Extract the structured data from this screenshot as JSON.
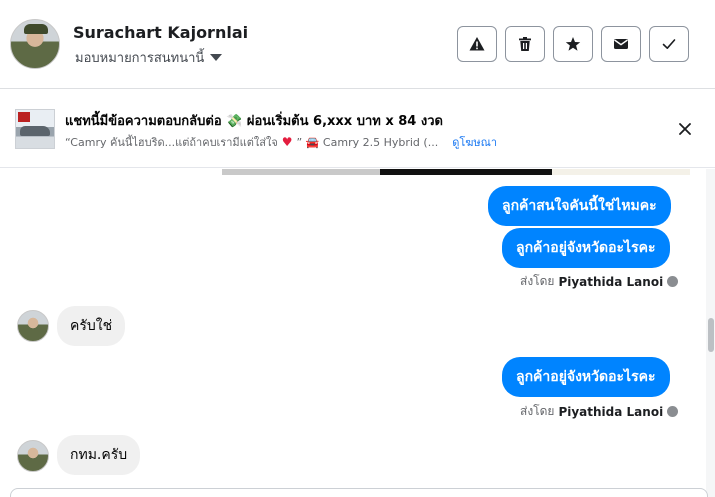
{
  "header": {
    "contact_name": "Surachart Kajornlai",
    "assign_label": "มอบหมายการสนทนานี้",
    "actions": [
      "warning-icon",
      "trash-icon",
      "star-icon",
      "mail-icon",
      "check-icon"
    ]
  },
  "ad": {
    "title": "แชทนี้มีข้อความตอบกลับต่อ 💸 ผ่อนเริ่มต้น 6,xxx บาท x 84 งวด",
    "subtitle_start": "“Camry คันนี้ไฮบริด...แต่ถ้าคบเรามีแต่ใส่ใจ",
    "subtitle_end": "” 🚘 Camry 2.5 Hybrid (...",
    "link": "ดูโฆษณา"
  },
  "messages": {
    "out_1": "ลูกค้าสนใจคันนี้ใช่ไหมคะ",
    "out_2": "ลูกค้าอยู่จังหวัดอะไรคะ",
    "sent_by_prefix": "ส่งโดย",
    "sent_by_name": "Piyathida Lanoi",
    "in_1": "ครับใช่",
    "out_3": "ลูกค้าอยู่จังหวัดอะไรคะ",
    "in_2": "กทม.ครับ"
  },
  "colors": {
    "accent": "#0084ff",
    "incoming_bubble": "#f0f0f0",
    "link": "#1877f2"
  }
}
